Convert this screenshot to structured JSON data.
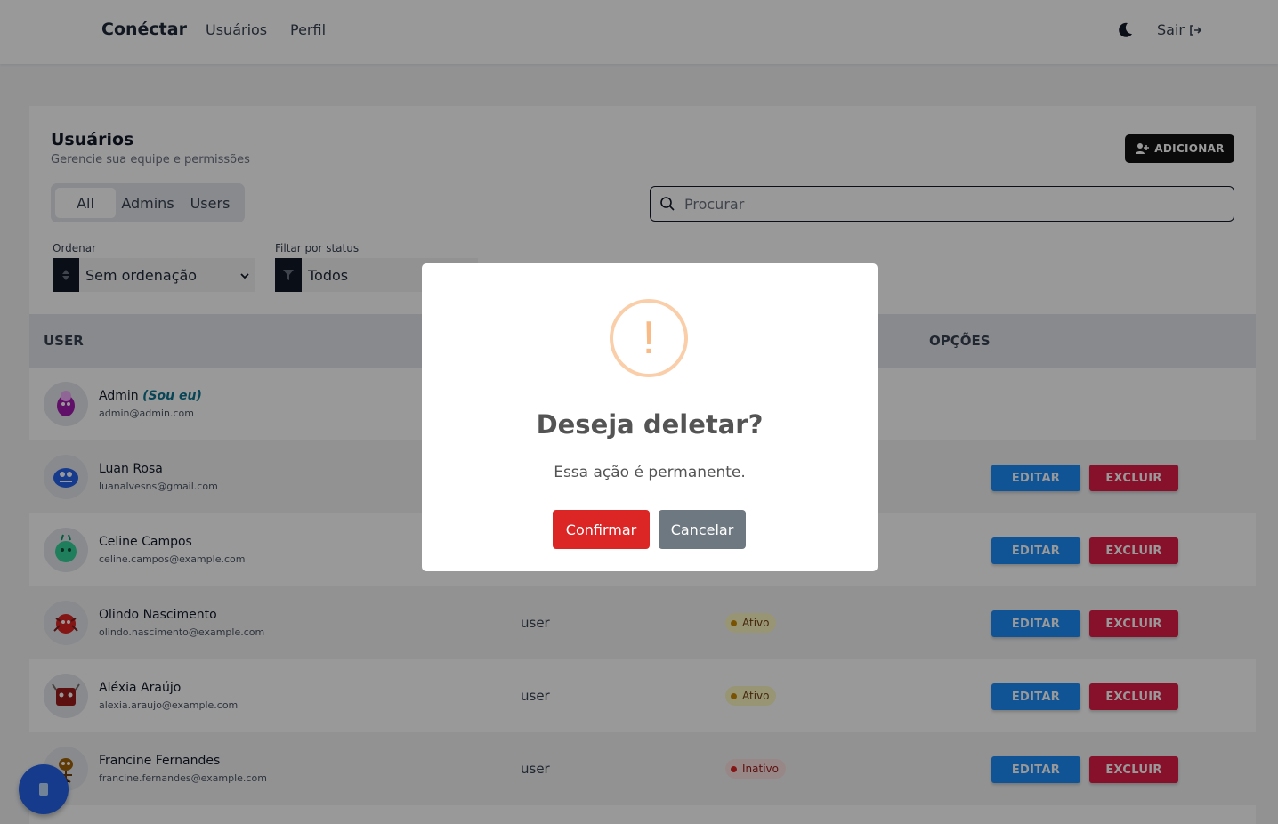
{
  "navbar": {
    "brand": "Conéctar",
    "links": [
      "Usuários",
      "Perfil"
    ],
    "logout_label": "Sair"
  },
  "card": {
    "title": "Usuários",
    "subtitle": "Gerencie sua equipe e permissões",
    "add_label": "ADICIONAR"
  },
  "tabs": [
    "All",
    "Admins",
    "Users"
  ],
  "search": {
    "placeholder": "Procurar"
  },
  "filters": {
    "order_label": "Ordenar",
    "order_value": "Sem ordenação",
    "status_label": "Filtar por status",
    "status_value": "Todos"
  },
  "table": {
    "headers": {
      "user": "USER",
      "options": "OPÇÕES"
    },
    "edit_label": "EDITAR",
    "delete_label": "EXCLUIR",
    "rows": [
      {
        "name": "Admin",
        "me": "(Sou eu)",
        "email": "admin@admin.com",
        "role": "",
        "status": ""
      },
      {
        "name": "Luan Rosa",
        "email": "luanalvesns@gmail.com",
        "role": "",
        "status": ""
      },
      {
        "name": "Celine Campos",
        "email": "celine.campos@example.com",
        "role": "",
        "status": ""
      },
      {
        "name": "Olindo Nascimento",
        "email": "olindo.nascimento@example.com",
        "role": "user",
        "status": "Ativo"
      },
      {
        "name": "Aléxia Araújo",
        "email": "alexia.araujo@example.com",
        "role": "user",
        "status": "Ativo"
      },
      {
        "name": "Francine Fernandes",
        "email": "francine.fernandes@example.com",
        "role": "user",
        "status": "Inativo"
      }
    ]
  },
  "modal": {
    "title": "Deseja deletar?",
    "text": "Essa ação é permanente.",
    "confirm_label": "Confirmar",
    "cancel_label": "Cancelar"
  },
  "colors": {
    "edit": "#1d8cf8",
    "delete": "#e11d48",
    "confirm": "#dc2626",
    "cancel": "#6e7881",
    "warning": "#f8bb86"
  }
}
